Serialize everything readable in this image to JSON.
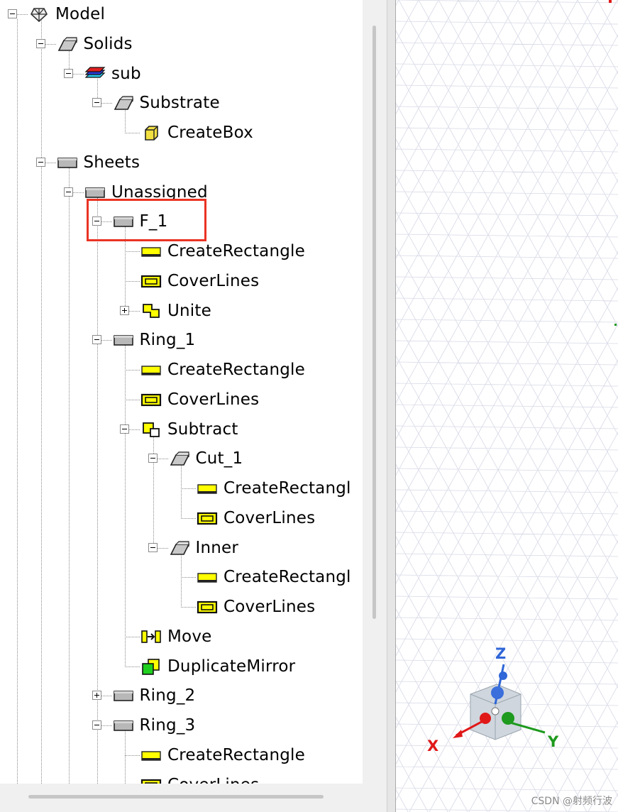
{
  "tree": {
    "items": [
      {
        "label": "Model",
        "icon": "model-icon",
        "expander": "minus"
      },
      {
        "label": "Solids",
        "icon": "solid-icon",
        "expander": "minus"
      },
      {
        "label": "sub",
        "icon": "material-stack-icon",
        "expander": "minus"
      },
      {
        "label": "Substrate",
        "icon": "solid-icon",
        "expander": "minus"
      },
      {
        "label": "CreateBox",
        "icon": "create-box-icon",
        "expander": "none"
      },
      {
        "label": "Sheets",
        "icon": "sheet-icon",
        "expander": "minus"
      },
      {
        "label": "Unassigned",
        "icon": "sheet-icon",
        "expander": "minus"
      },
      {
        "label": "F_1",
        "icon": "sheet-icon",
        "expander": "minus",
        "highlighted": true
      },
      {
        "label": "CreateRectangle",
        "icon": "create-rectangle-icon",
        "expander": "none"
      },
      {
        "label": "CoverLines",
        "icon": "cover-lines-icon",
        "expander": "none"
      },
      {
        "label": "Unite",
        "icon": "unite-icon",
        "expander": "plus"
      },
      {
        "label": "Ring_1",
        "icon": "sheet-icon",
        "expander": "minus"
      },
      {
        "label": "CreateRectangle",
        "icon": "create-rectangle-icon",
        "expander": "none"
      },
      {
        "label": "CoverLines",
        "icon": "cover-lines-icon",
        "expander": "none"
      },
      {
        "label": "Subtract",
        "icon": "subtract-icon",
        "expander": "minus"
      },
      {
        "label": "Cut_1",
        "icon": "solid-icon",
        "expander": "minus"
      },
      {
        "label": "CreateRectangl",
        "icon": "create-rectangle-icon",
        "expander": "none"
      },
      {
        "label": "CoverLines",
        "icon": "cover-lines-icon",
        "expander": "none"
      },
      {
        "label": "Inner",
        "icon": "solid-icon",
        "expander": "minus"
      },
      {
        "label": "CreateRectangl",
        "icon": "create-rectangle-icon",
        "expander": "none"
      },
      {
        "label": "CoverLines",
        "icon": "cover-lines-icon",
        "expander": "none"
      },
      {
        "label": "Move",
        "icon": "move-icon",
        "expander": "none"
      },
      {
        "label": "DuplicateMirror",
        "icon": "duplicate-mirror-icon",
        "expander": "none"
      },
      {
        "label": "Ring_2",
        "icon": "sheet-icon",
        "expander": "plus"
      },
      {
        "label": "Ring_3",
        "icon": "sheet-icon",
        "expander": "minus"
      },
      {
        "label": "CreateRectangle",
        "icon": "create-rectangle-icon",
        "expander": "none"
      },
      {
        "label": "CoverLines",
        "icon": "cover-lines-icon",
        "expander": "none"
      }
    ]
  },
  "viewport": {
    "axis": {
      "x_label": "X",
      "y_label": "Y",
      "z_label": "Z"
    },
    "watermark": "CSDN @射频行波"
  },
  "colors": {
    "highlight": "#ea3323",
    "rect_yellow": "#ffff00",
    "sheet_gray": "#b8b8b8",
    "axis_x": "#e01818",
    "axis_y": "#1e9a1e",
    "axis_z": "#2f66d8"
  }
}
